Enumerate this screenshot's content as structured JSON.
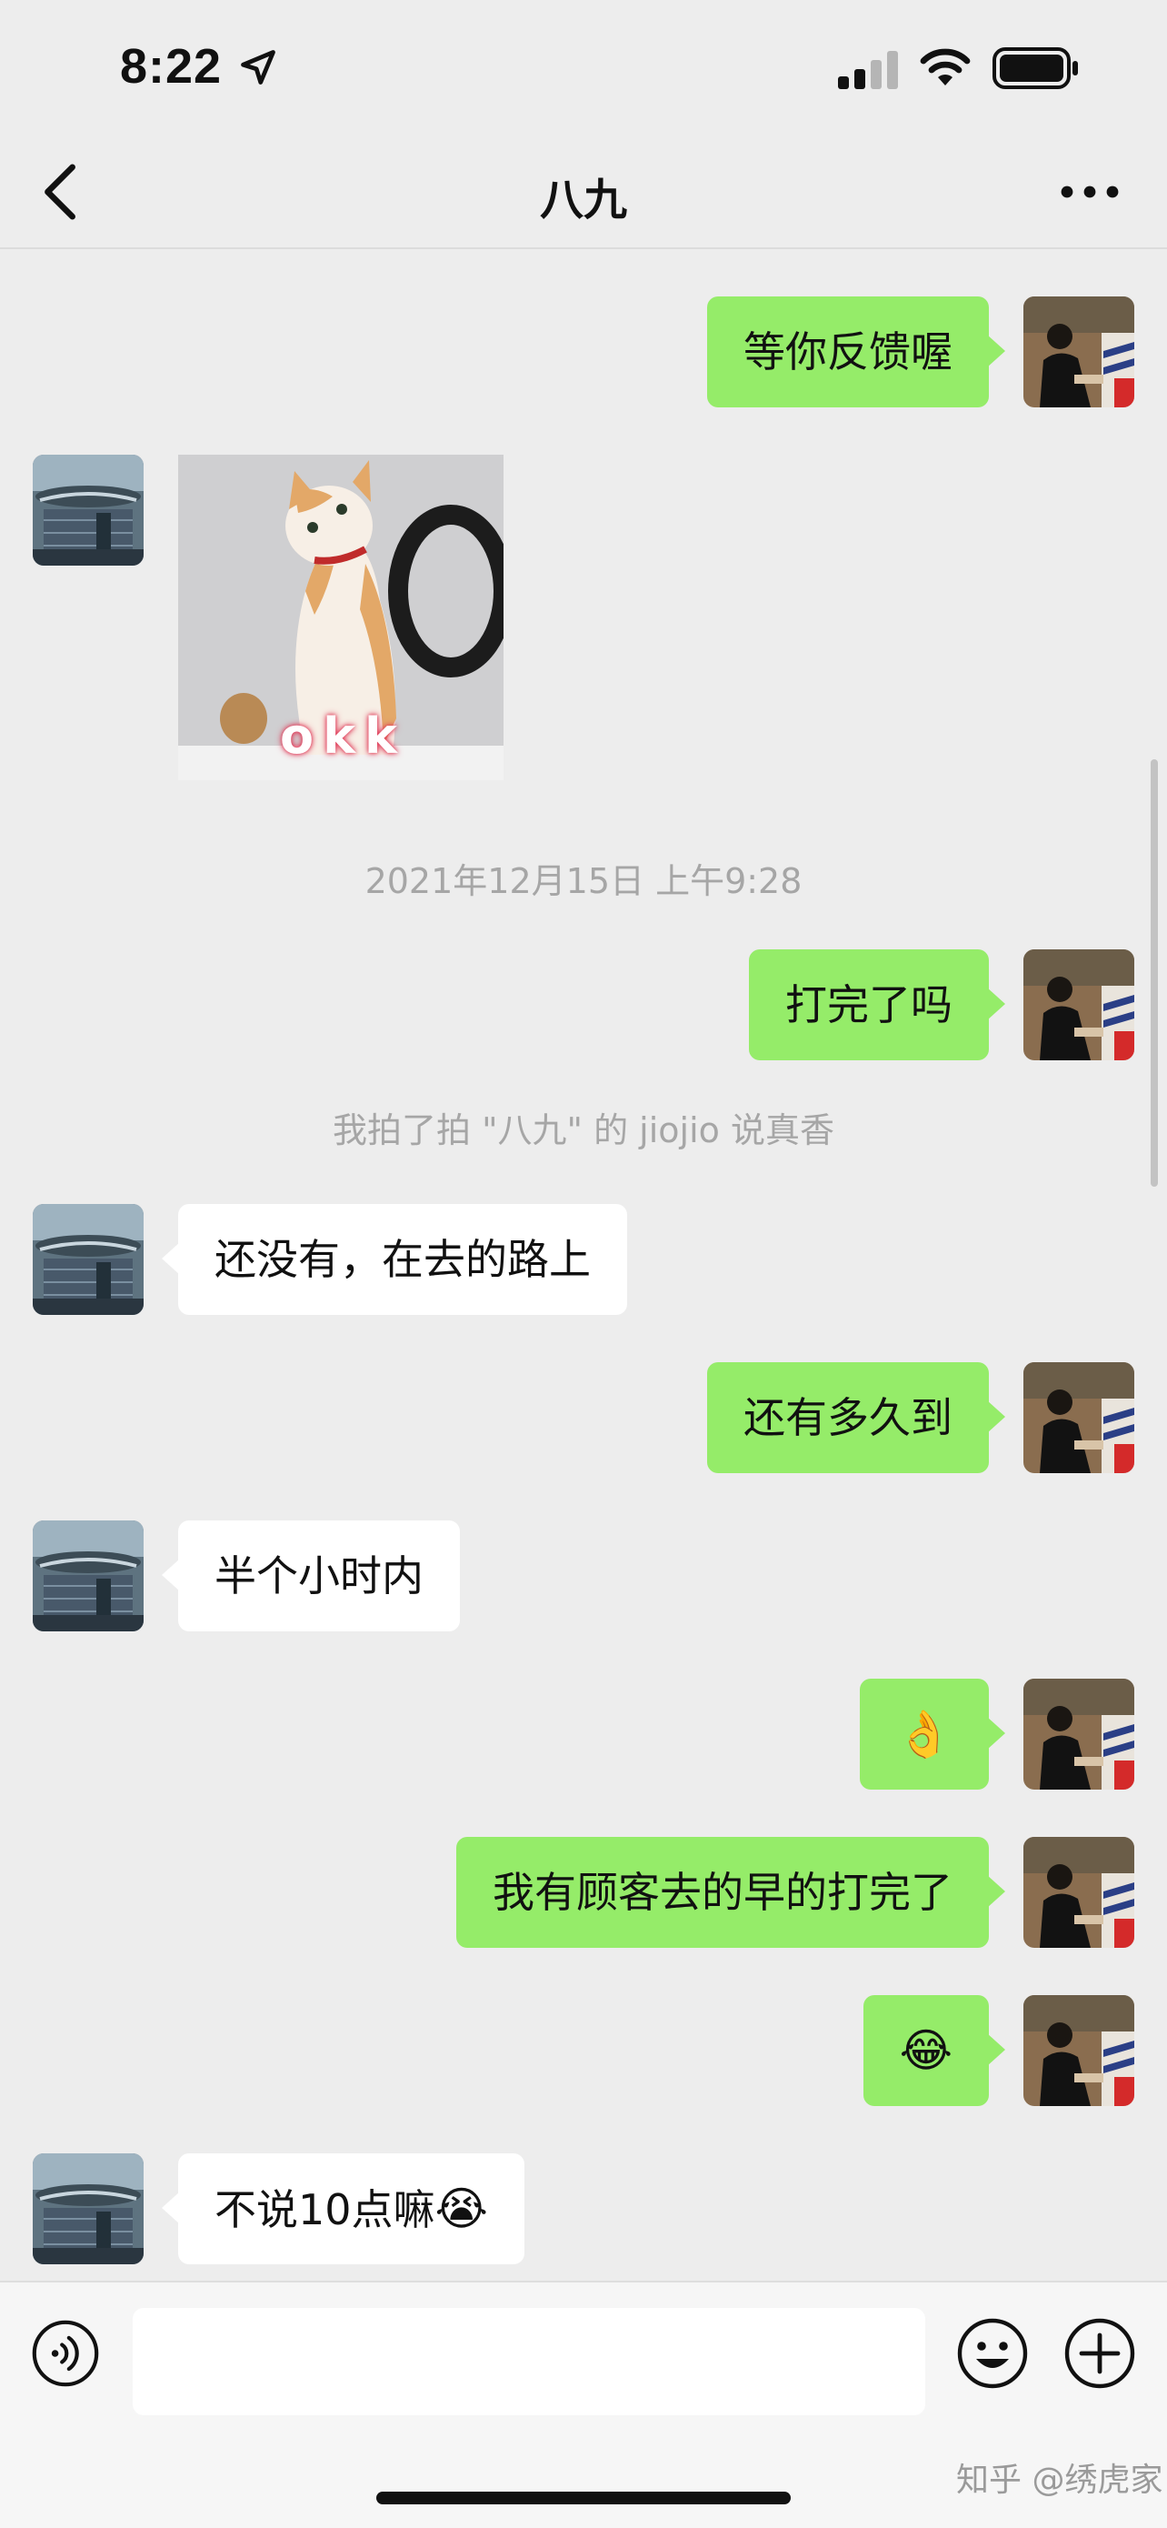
{
  "status_bar": {
    "time": "8:22",
    "icons": [
      "location-arrow-icon",
      "signal-icon",
      "wifi-icon",
      "battery-icon"
    ]
  },
  "nav": {
    "title": "八九",
    "back_icon": "chevron-left-icon",
    "more_icon": "more-dots-icon"
  },
  "messages": [
    {
      "from": "me",
      "text": "等你反馈喔"
    },
    {
      "from": "other",
      "type": "sticker",
      "sticker_text": "okk"
    },
    {
      "type": "time",
      "text": "2021年12月15日 上午9:28"
    },
    {
      "from": "me",
      "text": "打完了吗"
    },
    {
      "type": "system",
      "text": "我拍了拍 \"八九\" 的 jiojio 说真香"
    },
    {
      "from": "other",
      "text": "还没有，在去的路上"
    },
    {
      "from": "me",
      "text": "还有多久到"
    },
    {
      "from": "other",
      "text": "半个小时内"
    },
    {
      "from": "me",
      "text": "👌"
    },
    {
      "from": "me",
      "text": "我有顾客去的早的打完了"
    },
    {
      "from": "me",
      "text": "😂"
    },
    {
      "from": "other",
      "text": "不说10点嘛",
      "emoji": "😭"
    }
  ],
  "input_bar": {
    "text": "",
    "icons": [
      "voice-icon",
      "emoji-icon",
      "plus-icon"
    ]
  },
  "watermark": "知乎 @绣虎家",
  "colors": {
    "background": "#ededed",
    "my_bubble": "#95ec69",
    "other_bubble": "#ffffff"
  }
}
